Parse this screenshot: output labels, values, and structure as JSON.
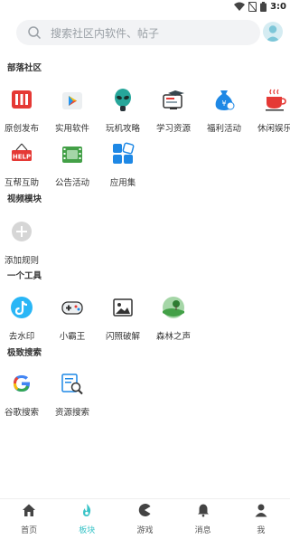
{
  "status_bar": {
    "time": "3:0"
  },
  "search": {
    "placeholder": "搜索社区内软件、帖子"
  },
  "sections": [
    {
      "title": "部落社区",
      "items": [
        "原创发布",
        "实用软件",
        "玩机攻略",
        "学习资源",
        "福利活动",
        "休闲娱乐",
        "互帮互助",
        "公告活动",
        "应用集"
      ]
    },
    {
      "title": "视频模块",
      "items": [
        "添加规则"
      ]
    },
    {
      "title": "一个工具",
      "items": [
        "去水印",
        "小霸王",
        "闪照破解",
        "森林之声"
      ]
    },
    {
      "title": "极致搜索",
      "items": [
        "谷歌搜索",
        "资源搜索"
      ]
    }
  ],
  "tabs": [
    {
      "label": "首页",
      "active": false
    },
    {
      "label": "板块",
      "active": true
    },
    {
      "label": "游戏",
      "active": false
    },
    {
      "label": "消息",
      "active": false
    },
    {
      "label": "我",
      "active": false
    }
  ],
  "colors": {
    "accent": "#38c3c7",
    "text": "#333333"
  }
}
